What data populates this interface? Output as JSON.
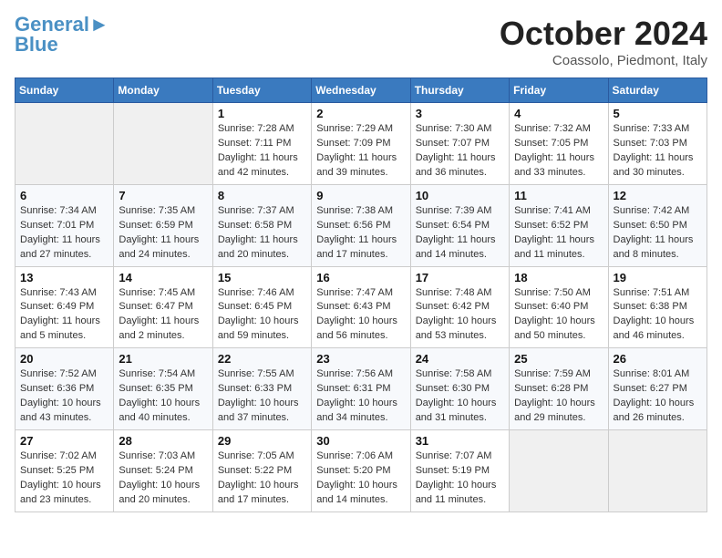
{
  "header": {
    "logo_line1": "General",
    "logo_line2": "Blue",
    "month": "October 2024",
    "location": "Coassolo, Piedmont, Italy"
  },
  "weekdays": [
    "Sunday",
    "Monday",
    "Tuesday",
    "Wednesday",
    "Thursday",
    "Friday",
    "Saturday"
  ],
  "weeks": [
    [
      {
        "day": "",
        "info": ""
      },
      {
        "day": "",
        "info": ""
      },
      {
        "day": "1",
        "info": "Sunrise: 7:28 AM\nSunset: 7:11 PM\nDaylight: 11 hours\nand 42 minutes."
      },
      {
        "day": "2",
        "info": "Sunrise: 7:29 AM\nSunset: 7:09 PM\nDaylight: 11 hours\nand 39 minutes."
      },
      {
        "day": "3",
        "info": "Sunrise: 7:30 AM\nSunset: 7:07 PM\nDaylight: 11 hours\nand 36 minutes."
      },
      {
        "day": "4",
        "info": "Sunrise: 7:32 AM\nSunset: 7:05 PM\nDaylight: 11 hours\nand 33 minutes."
      },
      {
        "day": "5",
        "info": "Sunrise: 7:33 AM\nSunset: 7:03 PM\nDaylight: 11 hours\nand 30 minutes."
      }
    ],
    [
      {
        "day": "6",
        "info": "Sunrise: 7:34 AM\nSunset: 7:01 PM\nDaylight: 11 hours\nand 27 minutes."
      },
      {
        "day": "7",
        "info": "Sunrise: 7:35 AM\nSunset: 6:59 PM\nDaylight: 11 hours\nand 24 minutes."
      },
      {
        "day": "8",
        "info": "Sunrise: 7:37 AM\nSunset: 6:58 PM\nDaylight: 11 hours\nand 20 minutes."
      },
      {
        "day": "9",
        "info": "Sunrise: 7:38 AM\nSunset: 6:56 PM\nDaylight: 11 hours\nand 17 minutes."
      },
      {
        "day": "10",
        "info": "Sunrise: 7:39 AM\nSunset: 6:54 PM\nDaylight: 11 hours\nand 14 minutes."
      },
      {
        "day": "11",
        "info": "Sunrise: 7:41 AM\nSunset: 6:52 PM\nDaylight: 11 hours\nand 11 minutes."
      },
      {
        "day": "12",
        "info": "Sunrise: 7:42 AM\nSunset: 6:50 PM\nDaylight: 11 hours\nand 8 minutes."
      }
    ],
    [
      {
        "day": "13",
        "info": "Sunrise: 7:43 AM\nSunset: 6:49 PM\nDaylight: 11 hours\nand 5 minutes."
      },
      {
        "day": "14",
        "info": "Sunrise: 7:45 AM\nSunset: 6:47 PM\nDaylight: 11 hours\nand 2 minutes."
      },
      {
        "day": "15",
        "info": "Sunrise: 7:46 AM\nSunset: 6:45 PM\nDaylight: 10 hours\nand 59 minutes."
      },
      {
        "day": "16",
        "info": "Sunrise: 7:47 AM\nSunset: 6:43 PM\nDaylight: 10 hours\nand 56 minutes."
      },
      {
        "day": "17",
        "info": "Sunrise: 7:48 AM\nSunset: 6:42 PM\nDaylight: 10 hours\nand 53 minutes."
      },
      {
        "day": "18",
        "info": "Sunrise: 7:50 AM\nSunset: 6:40 PM\nDaylight: 10 hours\nand 50 minutes."
      },
      {
        "day": "19",
        "info": "Sunrise: 7:51 AM\nSunset: 6:38 PM\nDaylight: 10 hours\nand 46 minutes."
      }
    ],
    [
      {
        "day": "20",
        "info": "Sunrise: 7:52 AM\nSunset: 6:36 PM\nDaylight: 10 hours\nand 43 minutes."
      },
      {
        "day": "21",
        "info": "Sunrise: 7:54 AM\nSunset: 6:35 PM\nDaylight: 10 hours\nand 40 minutes."
      },
      {
        "day": "22",
        "info": "Sunrise: 7:55 AM\nSunset: 6:33 PM\nDaylight: 10 hours\nand 37 minutes."
      },
      {
        "day": "23",
        "info": "Sunrise: 7:56 AM\nSunset: 6:31 PM\nDaylight: 10 hours\nand 34 minutes."
      },
      {
        "day": "24",
        "info": "Sunrise: 7:58 AM\nSunset: 6:30 PM\nDaylight: 10 hours\nand 31 minutes."
      },
      {
        "day": "25",
        "info": "Sunrise: 7:59 AM\nSunset: 6:28 PM\nDaylight: 10 hours\nand 29 minutes."
      },
      {
        "day": "26",
        "info": "Sunrise: 8:01 AM\nSunset: 6:27 PM\nDaylight: 10 hours\nand 26 minutes."
      }
    ],
    [
      {
        "day": "27",
        "info": "Sunrise: 7:02 AM\nSunset: 5:25 PM\nDaylight: 10 hours\nand 23 minutes."
      },
      {
        "day": "28",
        "info": "Sunrise: 7:03 AM\nSunset: 5:24 PM\nDaylight: 10 hours\nand 20 minutes."
      },
      {
        "day": "29",
        "info": "Sunrise: 7:05 AM\nSunset: 5:22 PM\nDaylight: 10 hours\nand 17 minutes."
      },
      {
        "day": "30",
        "info": "Sunrise: 7:06 AM\nSunset: 5:20 PM\nDaylight: 10 hours\nand 14 minutes."
      },
      {
        "day": "31",
        "info": "Sunrise: 7:07 AM\nSunset: 5:19 PM\nDaylight: 10 hours\nand 11 minutes."
      },
      {
        "day": "",
        "info": ""
      },
      {
        "day": "",
        "info": ""
      }
    ]
  ]
}
